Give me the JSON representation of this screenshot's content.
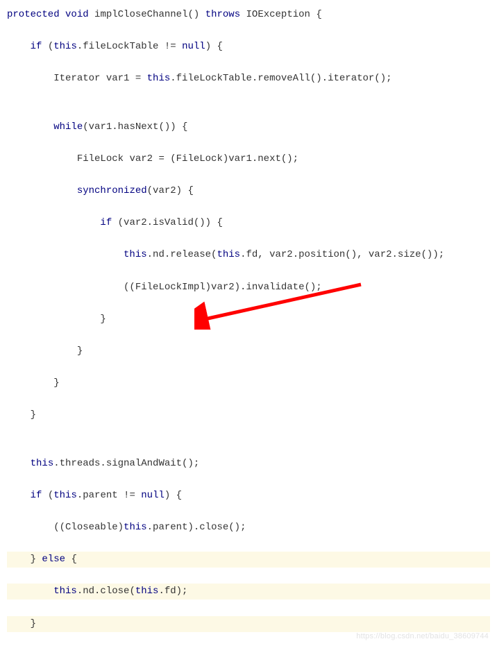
{
  "code": {
    "l1_kw_protected": "protected",
    "l1_kw_void": "void",
    "l1_method": "implCloseChannel()",
    "l1_kw_throws": "throws",
    "l1_ex": "IOException {",
    "l2_kw_if": "if",
    "l2_open": "(",
    "l2_this": "this",
    "l2_cond": ".fileLockTable !=",
    "l2_null": "null",
    "l2_close": ") {",
    "l3_decl": "Iterator var1 = ",
    "l3_this": "this",
    "l3_tail": ".fileLockTable.removeAll().iterator();",
    "l5_kw_while": "while",
    "l5_cond": "(var1.hasNext()) {",
    "l6_body": "FileLock var2 = (FileLock)var1.next();",
    "l7_kw_sync": "synchronized",
    "l7_arg": "(var2) {",
    "l8_kw_if": "if",
    "l8_cond": "(var2.isValid()) {",
    "l9_this1": "this",
    "l9_mid": ".nd.release(",
    "l9_this2": "this",
    "l9_tail": ".fd, var2.position(), var2.size());",
    "l10_body": "((FileLockImpl)var2).invalidate();",
    "l11_brace": "}",
    "l12_brace": "}",
    "l13_brace": "}",
    "l14_brace": "}",
    "l16_this": "this",
    "l16_tail": ".threads.signalAndWait();",
    "l17_kw_if": "if",
    "l17_open": "(",
    "l17_this": "this",
    "l17_cond": ".parent !=",
    "l17_null": "null",
    "l17_close": ") {",
    "l18_pre": "((Closeable)",
    "l18_this": "this",
    "l18_tail": ".parent).close();",
    "l19_close": "}",
    "l19_kw_else": "else",
    "l19_open": "{",
    "l20_this1": "this",
    "l20_mid": ".nd.close(",
    "l20_this2": "this",
    "l20_tail": ".fd);",
    "l21_brace": "}"
  },
  "watermark": "https://blog.csdn.net/baidu_38609744",
  "arrow": {
    "color": "#ff0000"
  }
}
